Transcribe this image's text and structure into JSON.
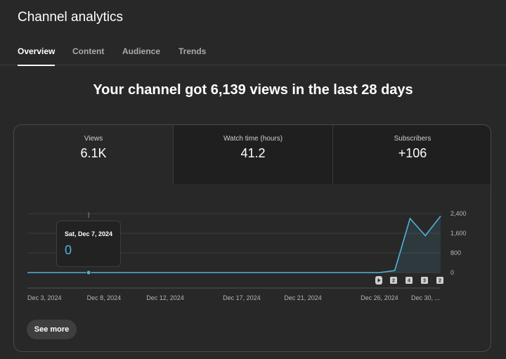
{
  "page": {
    "title": "Channel analytics"
  },
  "tabs": [
    {
      "label": "Overview",
      "active": true
    },
    {
      "label": "Content",
      "active": false
    },
    {
      "label": "Audience",
      "active": false
    },
    {
      "label": "Trends",
      "active": false
    }
  ],
  "headline": "Your channel got 6,139 views in the last 28 days",
  "metrics": [
    {
      "label": "Views",
      "value": "6.1K"
    },
    {
      "label": "Watch time (hours)",
      "value": "41.2"
    },
    {
      "label": "Subscribers",
      "value": "+106"
    }
  ],
  "tooltip": {
    "date": "Sat, Dec 7, 2024",
    "value": "0"
  },
  "see_more_label": "See more",
  "colors": {
    "line": "#4fb3d9",
    "accent_text": "#4fb3d9",
    "background": "#282828"
  },
  "markers": [
    {
      "type": "shorts-icon",
      "label": ""
    },
    {
      "type": "count",
      "label": "2"
    },
    {
      "type": "count",
      "label": "4"
    },
    {
      "type": "count",
      "label": "3"
    },
    {
      "type": "count",
      "label": "2"
    }
  ],
  "chart_data": {
    "type": "area",
    "x_ticks": [
      "Dec 3, 2024",
      "Dec 8, 2024",
      "Dec 12, 2024",
      "Dec 17, 2024",
      "Dec 21, 2024",
      "Dec 26, 2024",
      "Dec 30, ..."
    ],
    "x": [
      "2024-12-03",
      "2024-12-04",
      "2024-12-05",
      "2024-12-06",
      "2024-12-07",
      "2024-12-08",
      "2024-12-09",
      "2024-12-10",
      "2024-12-11",
      "2024-12-12",
      "2024-12-13",
      "2024-12-14",
      "2024-12-15",
      "2024-12-16",
      "2024-12-17",
      "2024-12-18",
      "2024-12-19",
      "2024-12-20",
      "2024-12-21",
      "2024-12-22",
      "2024-12-23",
      "2024-12-24",
      "2024-12-25",
      "2024-12-26",
      "2024-12-27",
      "2024-12-28",
      "2024-12-29",
      "2024-12-30"
    ],
    "series": [
      {
        "values": [
          0,
          0,
          0,
          0,
          0,
          0,
          0,
          0,
          0,
          0,
          0,
          0,
          0,
          0,
          0,
          0,
          0,
          0,
          0,
          0,
          0,
          0,
          0,
          0,
          80,
          2200,
          1500,
          2300
        ]
      }
    ],
    "y_ticks": [
      "2,400",
      "1,600",
      "800",
      "0"
    ],
    "ylim": [
      0,
      2400
    ],
    "grid": true,
    "highlight_index": 4
  }
}
